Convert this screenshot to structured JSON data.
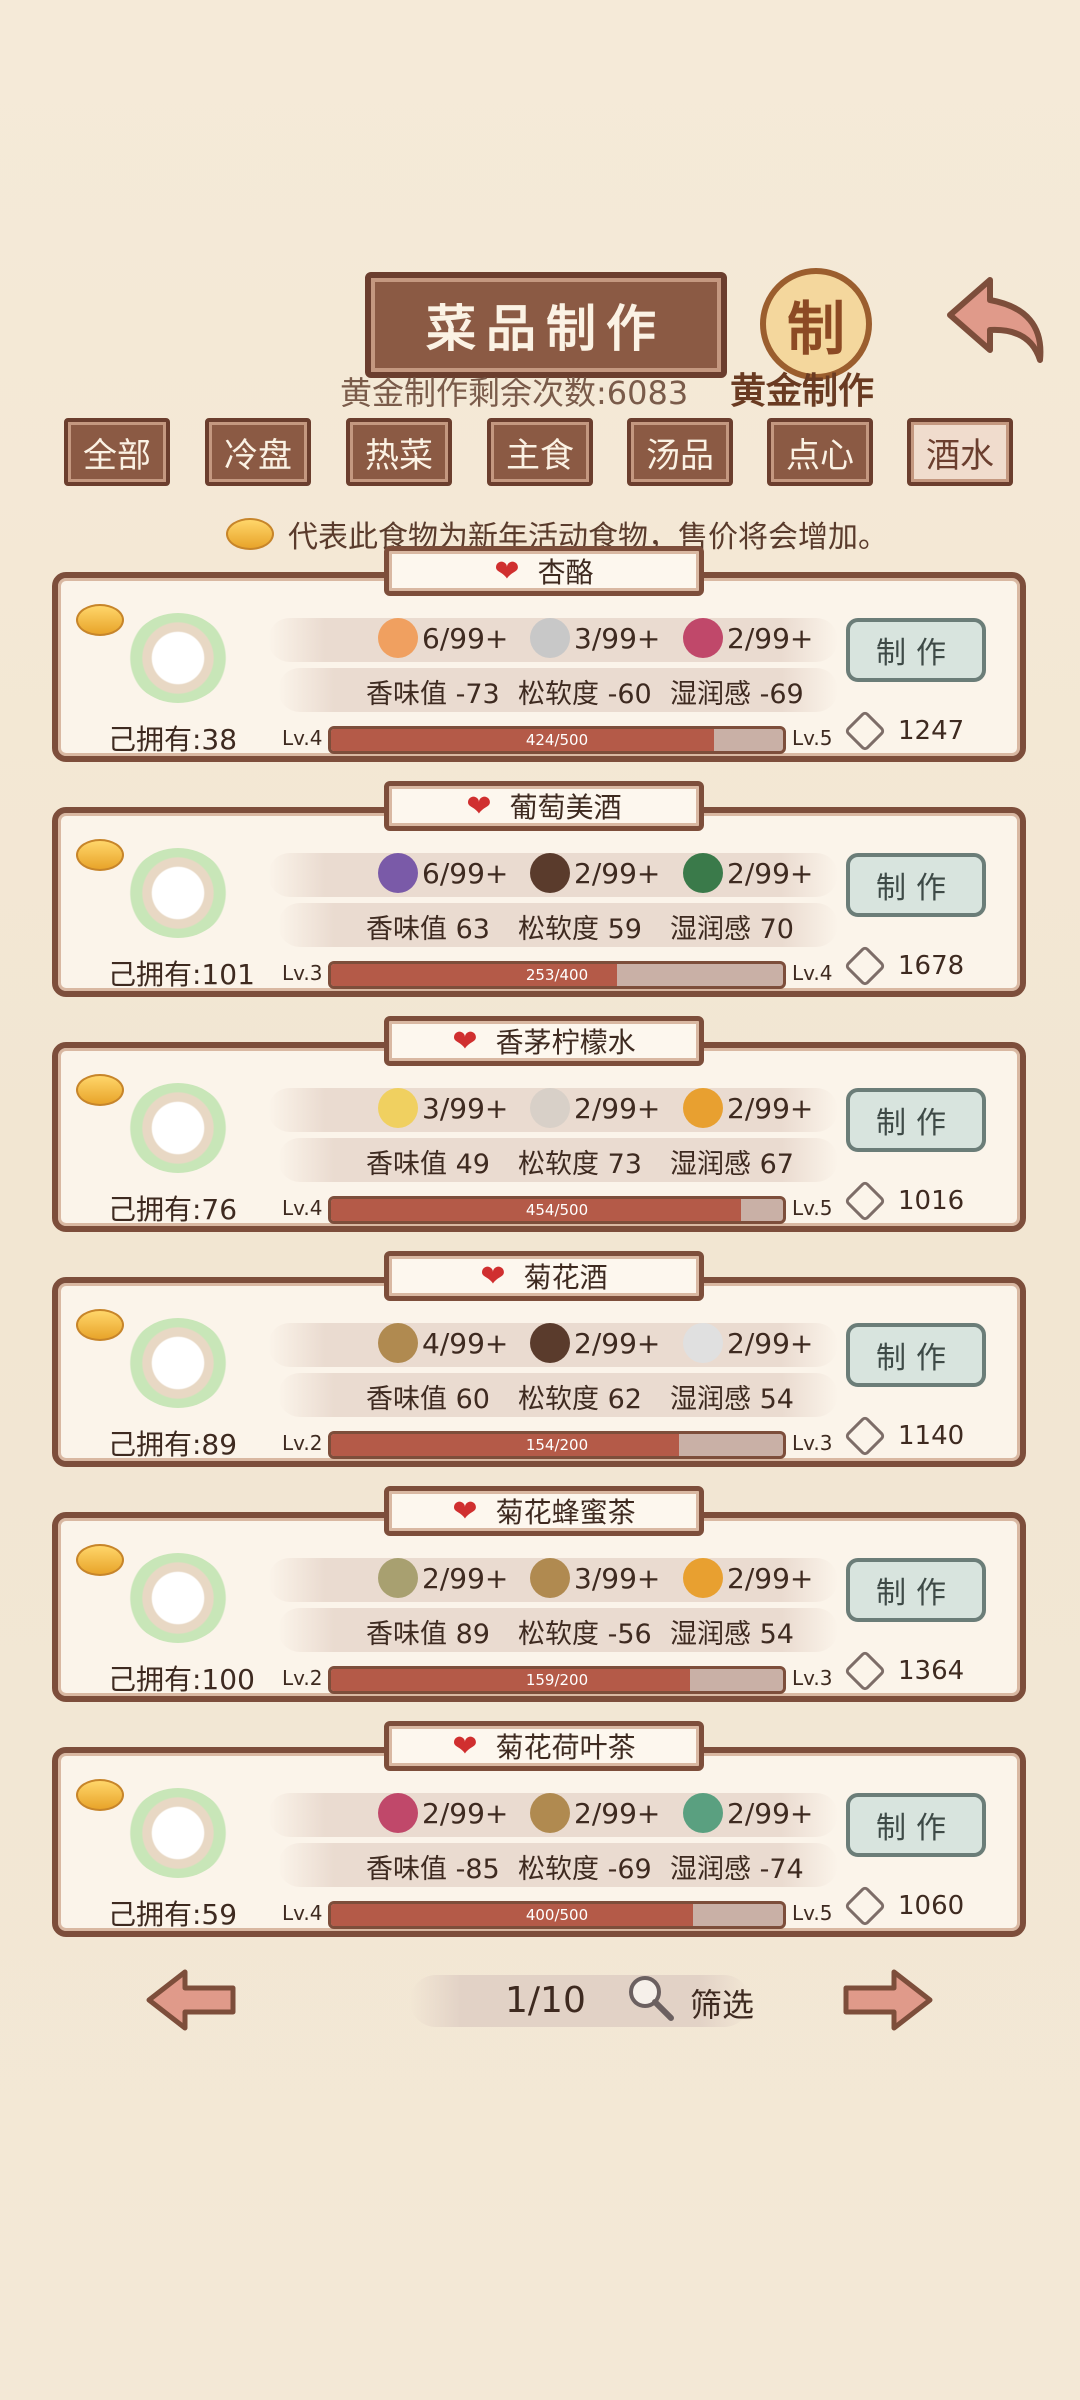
{
  "header": {
    "title": "菜品制作",
    "seal_char": "制",
    "seal_label": "黄金制作",
    "remaining": "黄金制作剩余次数:6083"
  },
  "tabs": [
    {
      "label": "全部"
    },
    {
      "label": "冷盘"
    },
    {
      "label": "热菜"
    },
    {
      "label": "主食"
    },
    {
      "label": "汤品"
    },
    {
      "label": "点心"
    },
    {
      "label": "酒水",
      "active": true
    }
  ],
  "legend_text": "代表此食物为新年活动食物，售价将会增加。",
  "recipes": [
    {
      "name": "杏酪",
      "owned": "己拥有:38",
      "ingredients": [
        {
          "icon": "peach-icon",
          "amount": "6/99+",
          "color": "#f0a060"
        },
        {
          "icon": "rice-bowl-icon",
          "amount": "3/99+",
          "color": "#c8c8c8"
        },
        {
          "icon": "flower-icon",
          "amount": "2/99+",
          "color": "#c0486a"
        }
      ],
      "stats": [
        "香味值 -73",
        "松软度 -60",
        "湿润感 -69"
      ],
      "lv_current": "Lv.4",
      "lv_next": "Lv.5",
      "progress_text": "424/500",
      "progress": 0.848,
      "make": "制作",
      "price": "1247"
    },
    {
      "name": "葡萄美酒",
      "owned": "己拥有:101",
      "ingredients": [
        {
          "icon": "grape-icon",
          "amount": "6/99+",
          "color": "#7a5aa8"
        },
        {
          "icon": "pot-icon",
          "amount": "2/99+",
          "color": "#5a3b2c"
        },
        {
          "icon": "jar-icon",
          "amount": "2/99+",
          "color": "#3a7a4a"
        }
      ],
      "stats": [
        "香味值 63",
        "松软度 59",
        "湿润感 70"
      ],
      "lv_current": "Lv.3",
      "lv_next": "Lv.4",
      "progress_text": "253/400",
      "progress": 0.6325,
      "make": "制作",
      "price": "1678"
    },
    {
      "name": "香茅柠檬水",
      "owned": "己拥有:76",
      "ingredients": [
        {
          "icon": "lemon-icon",
          "amount": "3/99+",
          "color": "#f0d060"
        },
        {
          "icon": "sugar-icon",
          "amount": "2/99+",
          "color": "#d8d0c8"
        },
        {
          "icon": "honey-jar-icon",
          "amount": "2/99+",
          "color": "#e8a030"
        }
      ],
      "stats": [
        "香味值 49",
        "松软度 73",
        "湿润感 67"
      ],
      "lv_current": "Lv.4",
      "lv_next": "Lv.5",
      "progress_text": "454/500",
      "progress": 0.908,
      "make": "制作",
      "price": "1016"
    },
    {
      "name": "菊花酒",
      "owned": "己拥有:89",
      "ingredients": [
        {
          "icon": "herb-icon",
          "amount": "4/99+",
          "color": "#b08a50"
        },
        {
          "icon": "pot-icon",
          "amount": "2/99+",
          "color": "#5a3b2c"
        },
        {
          "icon": "rice-icon",
          "amount": "2/99+",
          "color": "#e0e0e0"
        }
      ],
      "stats": [
        "香味值 60",
        "松软度 62",
        "湿润感 54"
      ],
      "lv_current": "Lv.2",
      "lv_next": "Lv.3",
      "progress_text": "154/200",
      "progress": 0.77,
      "make": "制作",
      "price": "1140"
    },
    {
      "name": "菊花蜂蜜茶",
      "owned": "己拥有:100",
      "ingredients": [
        {
          "icon": "tea-leaf-icon",
          "amount": "2/99+",
          "color": "#a8a070"
        },
        {
          "icon": "herb-icon",
          "amount": "3/99+",
          "color": "#b08a50"
        },
        {
          "icon": "honey-jar-icon",
          "amount": "2/99+",
          "color": "#e8a030"
        }
      ],
      "stats": [
        "香味值 89",
        "松软度 -56",
        "湿润感 54"
      ],
      "lv_current": "Lv.2",
      "lv_next": "Lv.3",
      "progress_text": "159/200",
      "progress": 0.795,
      "make": "制作",
      "price": "1364"
    },
    {
      "name": "菊花荷叶茶",
      "owned": "己拥有:59",
      "ingredients": [
        {
          "icon": "flower-icon",
          "amount": "2/99+",
          "color": "#c0486a"
        },
        {
          "icon": "herb-icon",
          "amount": "2/99+",
          "color": "#b08a50"
        },
        {
          "icon": "lotus-leaf-icon",
          "amount": "2/99+",
          "color": "#5aa080"
        }
      ],
      "stats": [
        "香味值 -85",
        "松软度 -69",
        "湿润感 -74"
      ],
      "lv_current": "Lv.4",
      "lv_next": "Lv.5",
      "progress_text": "400/500",
      "progress": 0.8,
      "make": "制作",
      "price": "1060"
    }
  ],
  "pagination": {
    "page": "1/10",
    "filter": "筛选"
  }
}
